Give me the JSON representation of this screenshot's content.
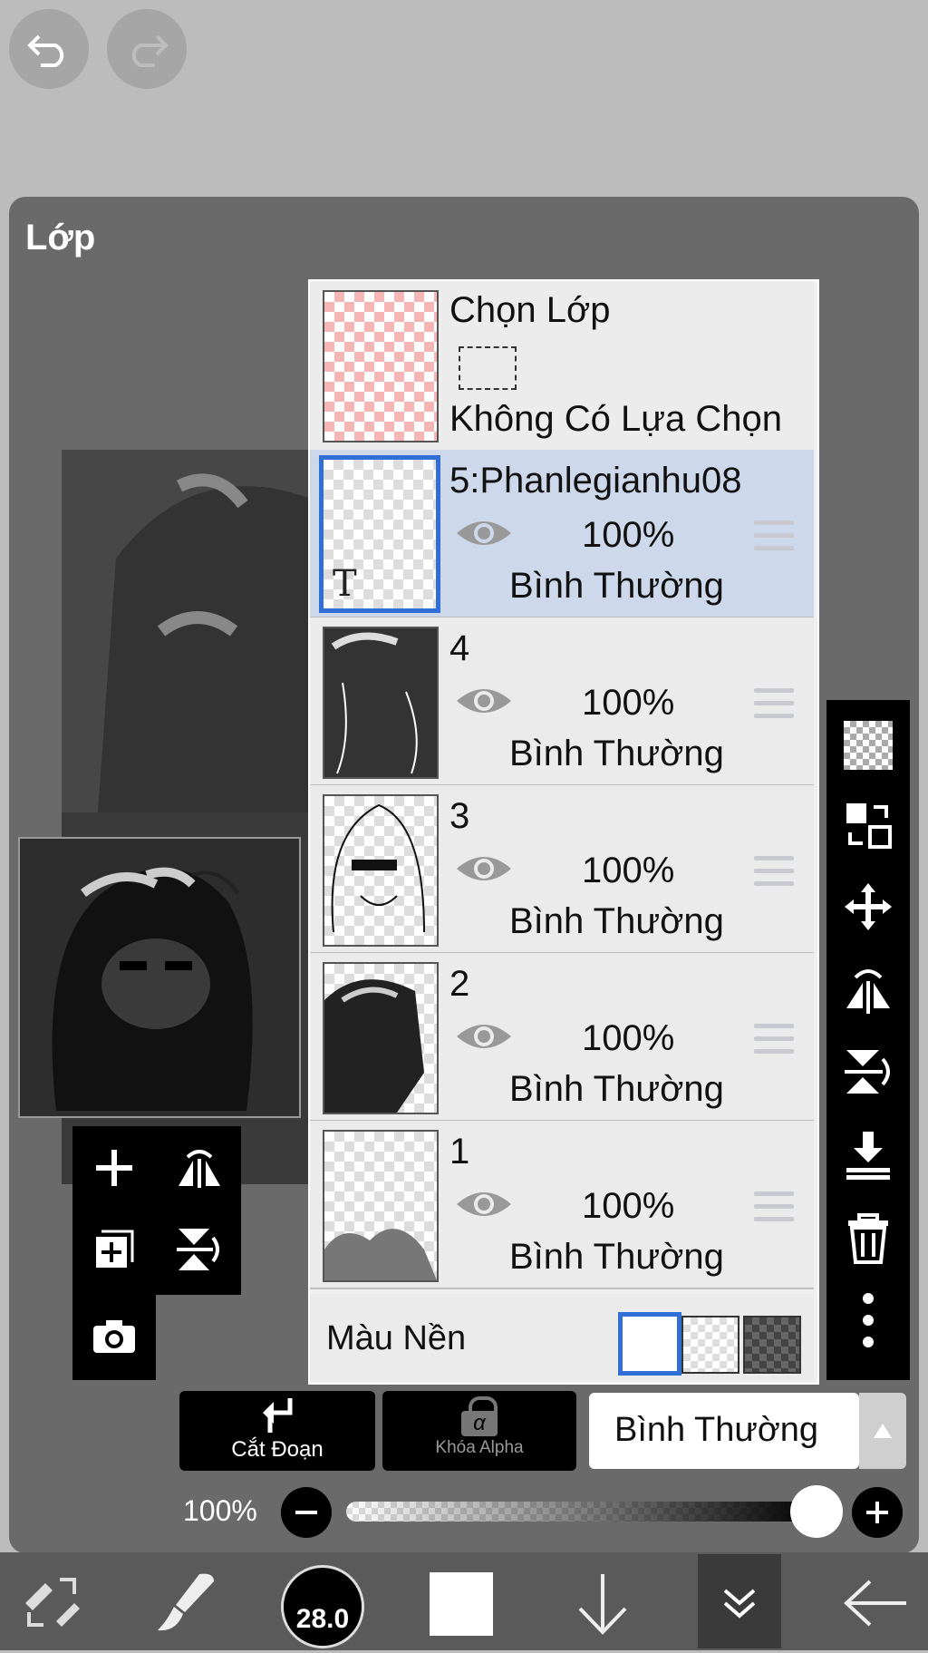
{
  "topbar": {
    "undo_icon": "undo-icon",
    "redo_icon": "redo-icon"
  },
  "panel": {
    "title": "Lớp"
  },
  "selection_layer": {
    "title": "Chọn Lớp",
    "status": "Không Có Lựa Chọn"
  },
  "layers": [
    {
      "name": "5:Phanlegianhu08",
      "opacity": "100%",
      "mode": "Bình Thường",
      "selected": true,
      "thumb_mark": "T"
    },
    {
      "name": "4",
      "opacity": "100%",
      "mode": "Bình Thường",
      "selected": false
    },
    {
      "name": "3",
      "opacity": "100%",
      "mode": "Bình Thường",
      "selected": false
    },
    {
      "name": "2",
      "opacity": "100%",
      "mode": "Bình Thường",
      "selected": false
    },
    {
      "name": "1",
      "opacity": "100%",
      "mode": "Bình Thường",
      "selected": false
    }
  ],
  "background": {
    "label": "Màu Nền"
  },
  "controls": {
    "clip_label": "Cắt Đoạn",
    "alpha_lock_label": "Khóa Alpha",
    "alpha_symbol": "α",
    "blend_mode": "Bình Thường",
    "opacity_value": "100%"
  },
  "bottombar": {
    "brush_size": "28.0"
  },
  "colors": {
    "accent": "#2f6fd6",
    "selected_row": "#cdd8eb",
    "panel": "#6a6a6a"
  }
}
